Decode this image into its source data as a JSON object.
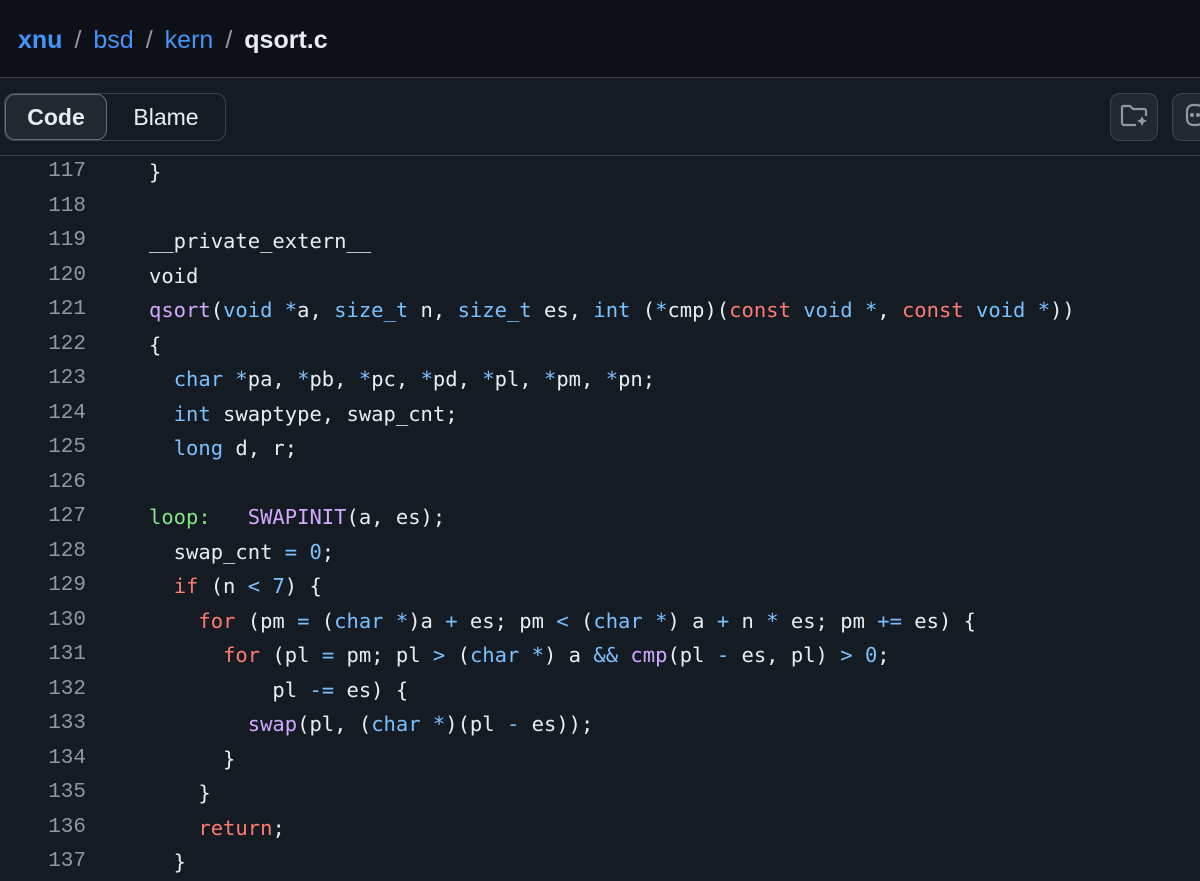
{
  "breadcrumb": {
    "repo": "xnu",
    "dir1": "bsd",
    "dir2": "kern",
    "file": "qsort.c",
    "separator": "/"
  },
  "toolbar": {
    "code_label": "Code",
    "blame_label": "Blame",
    "active_tab": "Code",
    "icons": [
      "copilot-folder-icon",
      "copilot-icon"
    ]
  },
  "colors": {
    "keyword": "#ff7b72",
    "type": "#79c0ff",
    "function": "#d2a8ff",
    "label": "#7ee787",
    "text": "#e6edf3",
    "line_number": "#9198a1",
    "link": "#4493f8"
  },
  "code": {
    "lines": [
      {
        "n": "117",
        "tokens": [
          [
            "",
            "}"
          ]
        ]
      },
      {
        "n": "118",
        "tokens": []
      },
      {
        "n": "119",
        "tokens": [
          [
            "",
            "__private_extern__"
          ]
        ]
      },
      {
        "n": "120",
        "tokens": [
          [
            "",
            "void"
          ]
        ]
      },
      {
        "n": "121",
        "tokens": [
          [
            "fn",
            "qsort"
          ],
          [
            "",
            "("
          ],
          [
            "ty",
            "void"
          ],
          [
            "",
            " "
          ],
          [
            "op",
            "*"
          ],
          [
            "",
            "a, "
          ],
          [
            "ty",
            "size_t"
          ],
          [
            "",
            " n, "
          ],
          [
            "ty",
            "size_t"
          ],
          [
            "",
            " es, "
          ],
          [
            "ty",
            "int"
          ],
          [
            "",
            " ("
          ],
          [
            "op",
            "*"
          ],
          [
            "",
            "cmp)("
          ],
          [
            "kw",
            "const"
          ],
          [
            "",
            " "
          ],
          [
            "ty",
            "void"
          ],
          [
            "",
            " "
          ],
          [
            "op",
            "*"
          ],
          [
            "",
            ", "
          ],
          [
            "kw",
            "const"
          ],
          [
            "",
            " "
          ],
          [
            "ty",
            "void"
          ],
          [
            "",
            " "
          ],
          [
            "op",
            "*"
          ],
          [
            "",
            "))"
          ]
        ]
      },
      {
        "n": "122",
        "tokens": [
          [
            "",
            "{"
          ]
        ]
      },
      {
        "n": "123",
        "tokens": [
          [
            "",
            "  "
          ],
          [
            "ty",
            "char"
          ],
          [
            "",
            " "
          ],
          [
            "op",
            "*"
          ],
          [
            "",
            "pa, "
          ],
          [
            "op",
            "*"
          ],
          [
            "",
            "pb, "
          ],
          [
            "op",
            "*"
          ],
          [
            "",
            "pc, "
          ],
          [
            "op",
            "*"
          ],
          [
            "",
            "pd, "
          ],
          [
            "op",
            "*"
          ],
          [
            "",
            "pl, "
          ],
          [
            "op",
            "*"
          ],
          [
            "",
            "pm, "
          ],
          [
            "op",
            "*"
          ],
          [
            "",
            "pn;"
          ]
        ]
      },
      {
        "n": "124",
        "tokens": [
          [
            "",
            "  "
          ],
          [
            "ty",
            "int"
          ],
          [
            "",
            " swaptype, swap_cnt;"
          ]
        ]
      },
      {
        "n": "125",
        "tokens": [
          [
            "",
            "  "
          ],
          [
            "ty",
            "long"
          ],
          [
            "",
            " d, r;"
          ]
        ]
      },
      {
        "n": "126",
        "tokens": []
      },
      {
        "n": "127",
        "tokens": [
          [
            "lb",
            "loop:"
          ],
          [
            "",
            "   "
          ],
          [
            "fn",
            "SWAPINIT"
          ],
          [
            "",
            "(a, es);"
          ]
        ]
      },
      {
        "n": "128",
        "tokens": [
          [
            "",
            "  swap_cnt "
          ],
          [
            "op",
            "="
          ],
          [
            "",
            " "
          ],
          [
            "num",
            "0"
          ],
          [
            "",
            ";"
          ]
        ]
      },
      {
        "n": "129",
        "tokens": [
          [
            "",
            "  "
          ],
          [
            "kw",
            "if"
          ],
          [
            "",
            " (n "
          ],
          [
            "op",
            "<"
          ],
          [
            "",
            " "
          ],
          [
            "num",
            "7"
          ],
          [
            "",
            ") {"
          ]
        ]
      },
      {
        "n": "130",
        "tokens": [
          [
            "",
            "    "
          ],
          [
            "kw",
            "for"
          ],
          [
            "",
            " (pm "
          ],
          [
            "op",
            "="
          ],
          [
            "",
            " ("
          ],
          [
            "ty",
            "char"
          ],
          [
            "",
            " "
          ],
          [
            "op",
            "*"
          ],
          [
            "",
            ")a "
          ],
          [
            "op",
            "+"
          ],
          [
            "",
            " es; pm "
          ],
          [
            "op",
            "<"
          ],
          [
            "",
            " ("
          ],
          [
            "ty",
            "char"
          ],
          [
            "",
            " "
          ],
          [
            "op",
            "*"
          ],
          [
            "",
            ") a "
          ],
          [
            "op",
            "+"
          ],
          [
            "",
            " n "
          ],
          [
            "op",
            "*"
          ],
          [
            "",
            " es; pm "
          ],
          [
            "op",
            "+="
          ],
          [
            "",
            " es) {"
          ]
        ]
      },
      {
        "n": "131",
        "tokens": [
          [
            "",
            "      "
          ],
          [
            "kw",
            "for"
          ],
          [
            "",
            " (pl "
          ],
          [
            "op",
            "="
          ],
          [
            "",
            " pm; pl "
          ],
          [
            "op",
            ">"
          ],
          [
            "",
            " ("
          ],
          [
            "ty",
            "char"
          ],
          [
            "",
            " "
          ],
          [
            "op",
            "*"
          ],
          [
            "",
            ") a "
          ],
          [
            "op",
            "&&"
          ],
          [
            "",
            " "
          ],
          [
            "fn",
            "cmp"
          ],
          [
            "",
            "(pl "
          ],
          [
            "op",
            "-"
          ],
          [
            "",
            " es, pl) "
          ],
          [
            "op",
            ">"
          ],
          [
            "",
            " "
          ],
          [
            "num",
            "0"
          ],
          [
            "",
            ";"
          ]
        ]
      },
      {
        "n": "132",
        "tokens": [
          [
            "",
            "          pl "
          ],
          [
            "op",
            "-="
          ],
          [
            "",
            " es) {"
          ]
        ]
      },
      {
        "n": "133",
        "tokens": [
          [
            "",
            "        "
          ],
          [
            "fn",
            "swap"
          ],
          [
            "",
            "(pl, ("
          ],
          [
            "ty",
            "char"
          ],
          [
            "",
            " "
          ],
          [
            "op",
            "*"
          ],
          [
            "",
            ")(pl "
          ],
          [
            "op",
            "-"
          ],
          [
            "",
            " es));"
          ]
        ]
      },
      {
        "n": "134",
        "tokens": [
          [
            "",
            "      }"
          ]
        ]
      },
      {
        "n": "135",
        "tokens": [
          [
            "",
            "    }"
          ]
        ]
      },
      {
        "n": "136",
        "tokens": [
          [
            "",
            "    "
          ],
          [
            "kw",
            "return"
          ],
          [
            "",
            ";"
          ]
        ]
      },
      {
        "n": "137",
        "tokens": [
          [
            "",
            "  }"
          ]
        ]
      }
    ]
  }
}
